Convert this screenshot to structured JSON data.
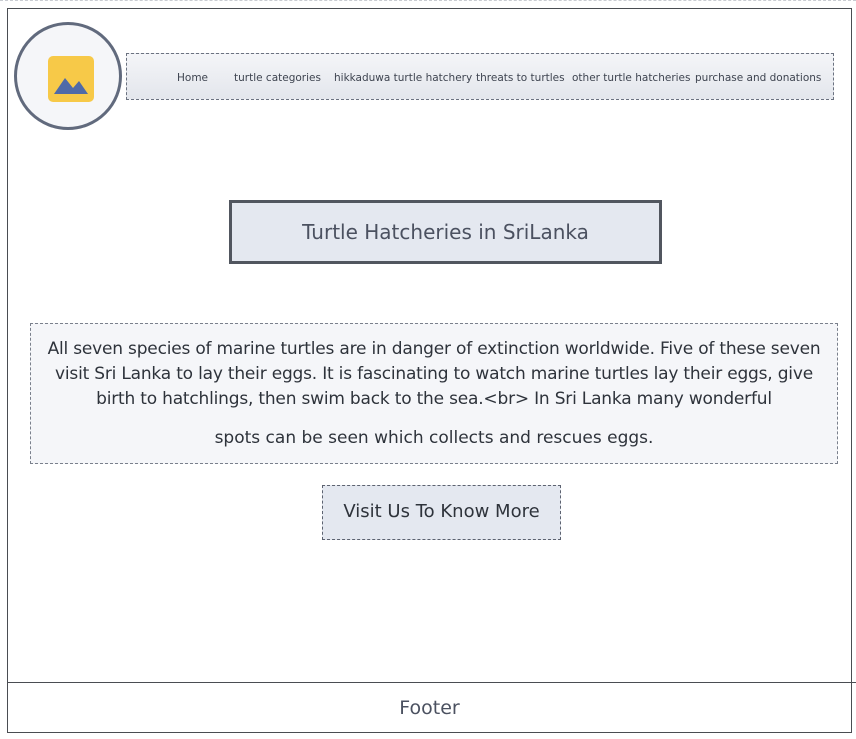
{
  "logo": {
    "icon": "image-placeholder-icon",
    "colors": {
      "background": "#f7c948",
      "mountain": "#4f6aa8"
    }
  },
  "nav": {
    "items": [
      {
        "label": "Home"
      },
      {
        "label": "turtle categories"
      },
      {
        "label": "hikkaduwa turtle hatchery"
      },
      {
        "label": "threats to turtles"
      },
      {
        "label": "other turtle hatcheries"
      },
      {
        "label": "purchase and donations"
      }
    ]
  },
  "hero": {
    "title": "Turtle Hatcheries in SriLanka",
    "description": "All seven species of marine turtles are in danger of extinction worldwide. Five of these seven visit Sri Lanka to lay their eggs. It is fascinating to watch marine turtles lay their eggs, give birth to hatchlings, then swim back to the sea.<br> In Sri Lanka many wonderful",
    "description_tail": "spots can be seen which collects and rescues eggs.",
    "cta_label": "Visit Us To Know More"
  },
  "footer": {
    "label": "Footer"
  }
}
